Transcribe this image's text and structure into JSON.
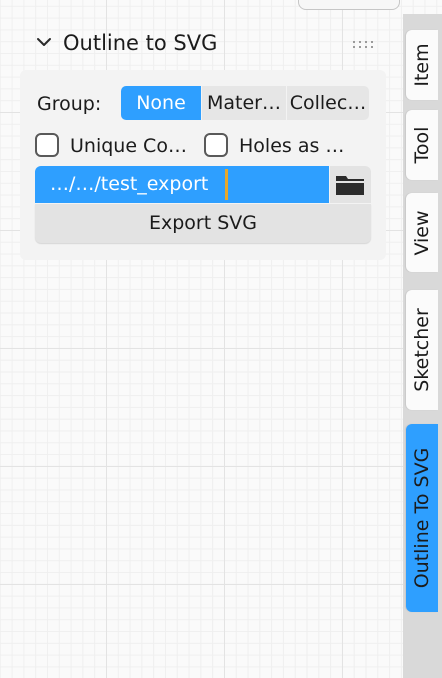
{
  "panel": {
    "title": "Outline to SVG",
    "group_label": "Group:",
    "group_options": [
      "None",
      "Mater…",
      "Collec…"
    ],
    "group_selected": "None",
    "unique_checkbox_label": "Unique Co…",
    "holes_checkbox_label": "Holes as …",
    "unique_checked": false,
    "holes_checked": false,
    "path_value": "…/…/test_export",
    "export_label": "Export SVG"
  },
  "tabs": [
    "Item",
    "Tool",
    "View",
    "Sketcher",
    "Outline To SVG"
  ],
  "active_tab": "Outline To SVG",
  "icons": {
    "collapse": "chevron-down-icon",
    "drag": "drag-handle-icon",
    "folder": "folder-icon"
  },
  "colors": {
    "accent": "#2e9fff",
    "cursor": "#e7a82c"
  }
}
